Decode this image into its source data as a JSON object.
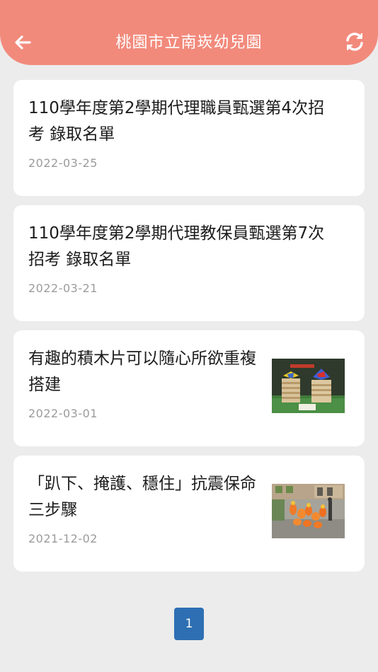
{
  "header": {
    "title": "桃園市立南崁幼兒園",
    "back_icon": "arrow-left-icon",
    "refresh_icon": "refresh-icon"
  },
  "news": [
    {
      "title": "110學年度第2學期代理職員甄選第4次招考 錄取名單",
      "date": "2022-03-25"
    },
    {
      "title": "110學年度第2學期代理教保員甄選第7次招考 錄取名單",
      "date": "2022-03-21"
    },
    {
      "title": "有趣的積木片可以隨心所欲重複搭建",
      "date": "2022-03-01"
    },
    {
      "title": "「趴下、掩護、穩住」抗震保命三步驟",
      "date": "2021-12-02"
    }
  ],
  "pagination": {
    "current": "1"
  },
  "colors": {
    "header_bg": "#f28a7c",
    "page_bg": "#ececec",
    "pagination_bg": "#2e6fb3"
  }
}
